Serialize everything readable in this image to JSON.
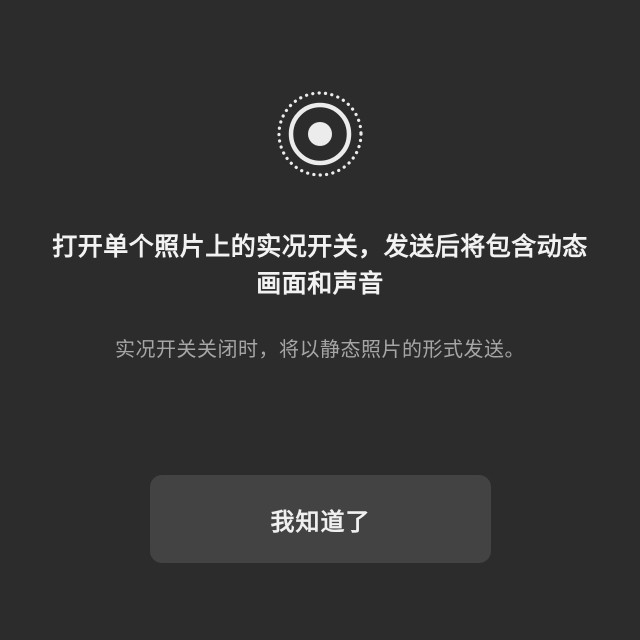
{
  "dialog": {
    "icon": "live-photo-icon",
    "headline_line1": "打开单个照片上的实况开关，发送后将包含动态",
    "headline_line2": "画面和声音",
    "subtext": "实况开关关闭时，将以静态照片的形式发送。",
    "button_label": "我知道了"
  },
  "colors": {
    "background": "#2c2c2c",
    "headline": "#f2f2f2",
    "subtext": "#a6a6a6",
    "button_bg": "#434343",
    "icon": "#ececec"
  }
}
